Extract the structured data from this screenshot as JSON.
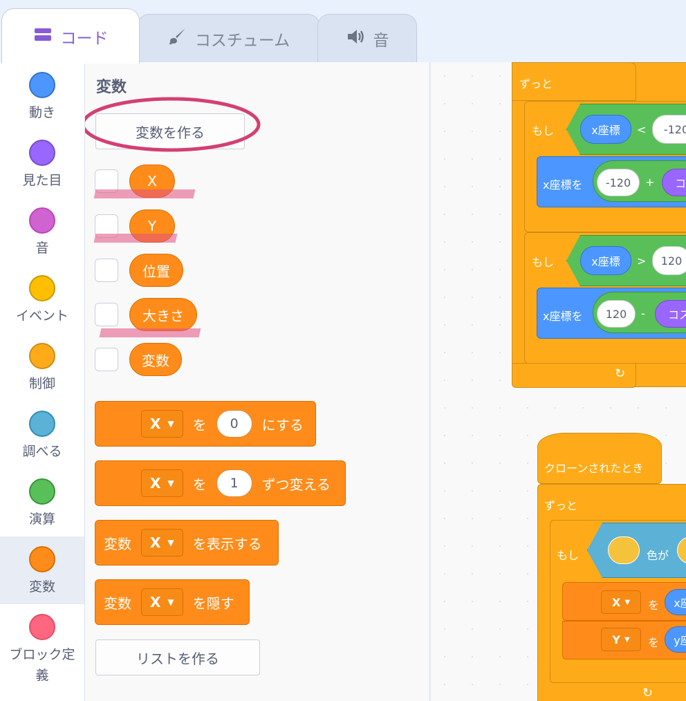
{
  "tabs": [
    {
      "label": "コード",
      "icon": "code-icon",
      "active": true
    },
    {
      "label": "コスチューム",
      "icon": "brush-icon",
      "active": false
    },
    {
      "label": "音",
      "icon": "speaker-icon",
      "active": false
    }
  ],
  "categories": [
    {
      "label": "動き",
      "color": "#4c97ff"
    },
    {
      "label": "見た目",
      "color": "#9966ff"
    },
    {
      "label": "音",
      "color": "#cf63cf"
    },
    {
      "label": "イベント",
      "color": "#ffbf00"
    },
    {
      "label": "制御",
      "color": "#ffab19"
    },
    {
      "label": "調べる",
      "color": "#5cb1d6"
    },
    {
      "label": "演算",
      "color": "#59c059"
    },
    {
      "label": "変数",
      "color": "#ff8c1a",
      "selected": true
    },
    {
      "label": "ブロック定義",
      "color": "#ff6680"
    }
  ],
  "palette": {
    "title": "変数",
    "make_variable_button": "変数を作る",
    "variables": [
      "X",
      "Y",
      "位置",
      "大きさ",
      "変数"
    ],
    "set_block": {
      "var": "X",
      "word": "を",
      "value": "0",
      "suffix": "にする"
    },
    "change_block": {
      "var": "X",
      "word": "を",
      "value": "1",
      "suffix": "ずつ変える"
    },
    "show_block": {
      "prefix": "変数",
      "var": "X",
      "suffix": "を表示する"
    },
    "hide_block": {
      "prefix": "変数",
      "var": "X",
      "suffix": "を隠す"
    },
    "make_list_button": "リストを作る"
  },
  "code": {
    "script1": {
      "forever": "ずっと",
      "if1": {
        "label": "もし",
        "reporter": "x座標",
        "operator": "<",
        "value": "-120"
      },
      "set1": {
        "label": "x座標を",
        "value": "-120",
        "operator": "+",
        "reporter": "コス"
      },
      "if2": {
        "label": "もし",
        "reporter": "x座標",
        "operator": ">",
        "value": "120"
      },
      "set2": {
        "label": "x座標を",
        "value": "120",
        "operator": "-",
        "reporter": "コス"
      }
    },
    "script2": {
      "hat": "クローンされたとき",
      "forever": "ずっと",
      "if": {
        "label": "もし",
        "color_word": "色が"
      },
      "set_x": {
        "var": "X",
        "word": "を",
        "reporter": "x座"
      },
      "set_y": {
        "var": "Y",
        "word": "を",
        "reporter": "y座"
      }
    }
  }
}
